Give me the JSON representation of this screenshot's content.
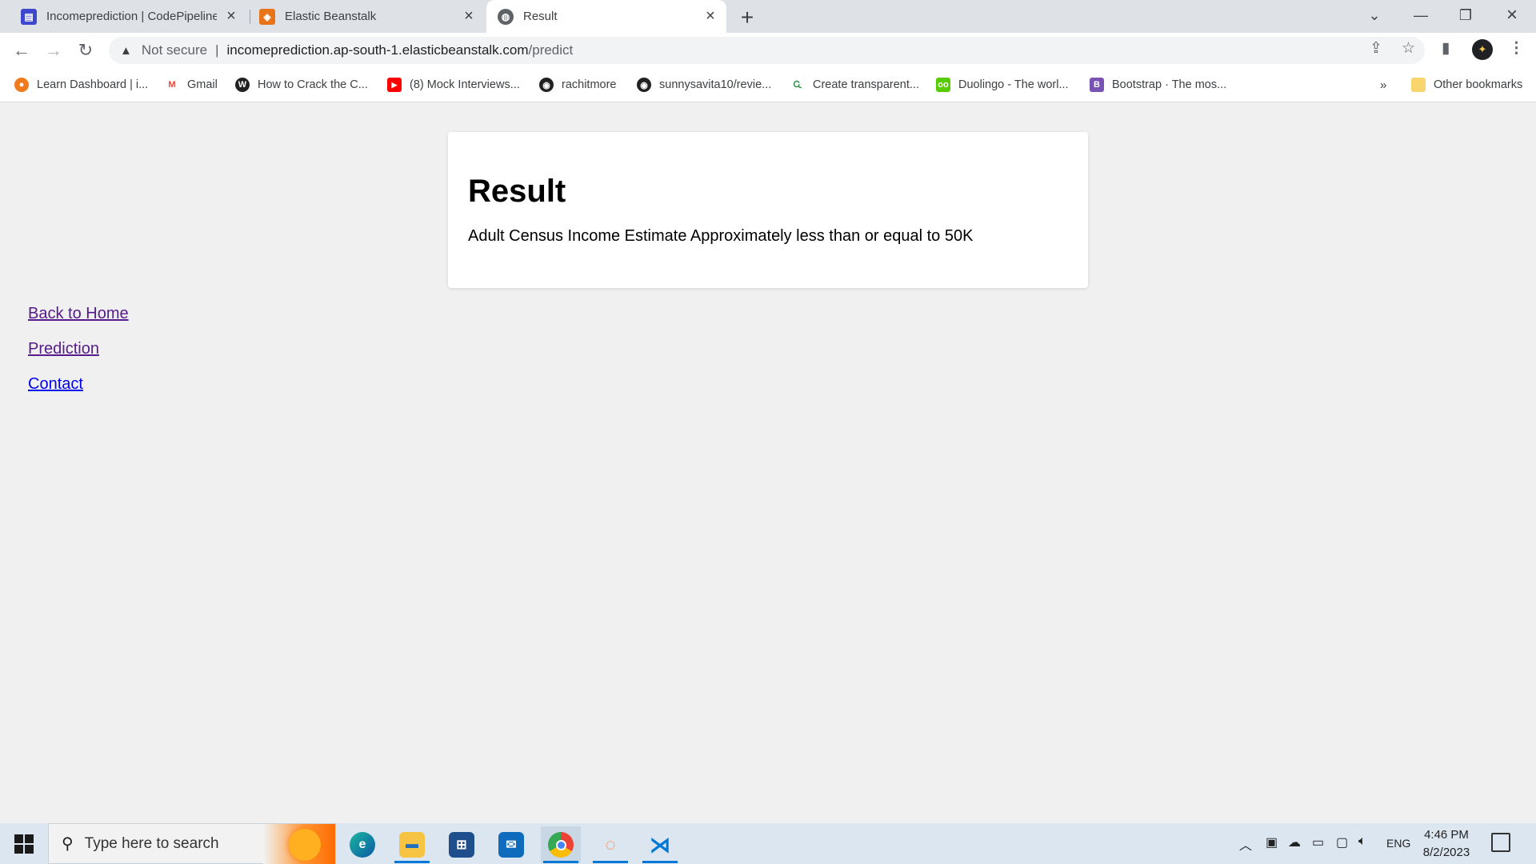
{
  "browser": {
    "tabs": [
      {
        "title": "Incomeprediction | CodePipeline",
        "icon": "codepipeline-icon",
        "color": "#3f48cc"
      },
      {
        "title": "Elastic Beanstalk",
        "icon": "elastic-beanstalk-icon",
        "color": "#e8741a"
      },
      {
        "title": "Result",
        "icon": "globe-icon",
        "active": true
      }
    ],
    "address": {
      "security_label": "Not secure",
      "host": "incomeprediction.ap-south-1.elasticbeanstalk.com",
      "path": "/predict"
    },
    "bookmarks": [
      {
        "label": "Learn Dashboard | i...",
        "icon": "learn-dashboard-icon",
        "color": "#f07b1d"
      },
      {
        "label": "Gmail",
        "icon": "gmail-icon",
        "color": "#ea4335"
      },
      {
        "label": "How to Crack the C...",
        "icon": "wordpress-icon",
        "color": "#222222"
      },
      {
        "label": "(8) Mock Interviews...",
        "icon": "youtube-icon",
        "color": "#ff0000"
      },
      {
        "label": "rachitmore",
        "icon": "github-icon",
        "color": "#222222"
      },
      {
        "label": "sunnysavita10/revie...",
        "icon": "github-icon",
        "color": "#222222"
      },
      {
        "label": "Create transparent...",
        "icon": "geeksforgeeks-icon",
        "color": "#2f8d46"
      },
      {
        "label": "Duolingo - The worl...",
        "icon": "duolingo-icon",
        "color": "#58cc02"
      },
      {
        "label": "Bootstrap · The mos...",
        "icon": "bootstrap-icon",
        "color": "#7952b3"
      }
    ],
    "overflow_label": "»",
    "other_bookmarks": "Other bookmarks"
  },
  "page": {
    "heading": "Result",
    "result_text": "Adult Census Income Estimate Approximately less than or equal to 50K",
    "links": [
      {
        "label": "Back to Home",
        "visited": true
      },
      {
        "label": "Prediction",
        "visited": true
      },
      {
        "label": "Contact",
        "visited": false
      }
    ]
  },
  "taskbar": {
    "search_placeholder": "Type here to search",
    "language": "ENG",
    "time": "4:46 PM",
    "date": "8/2/2023"
  }
}
